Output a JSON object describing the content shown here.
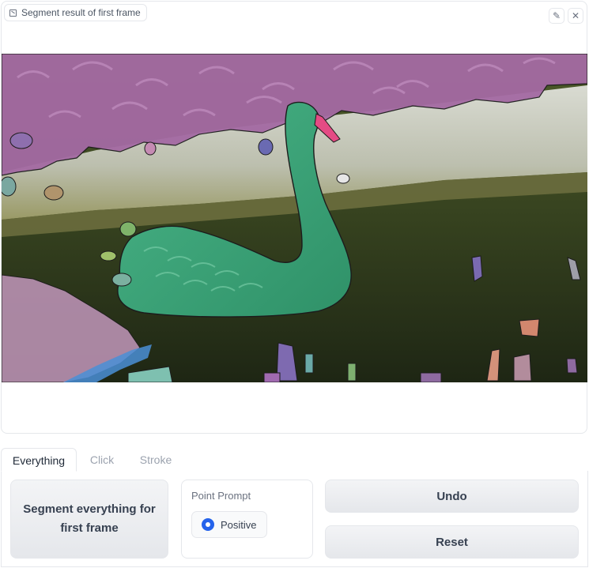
{
  "panel": {
    "label": "Segment result of first frame",
    "label_icon": "image-icon",
    "edit_icon": "pencil-icon",
    "close_icon": "close-icon"
  },
  "image": {
    "subject": "swan-segmentation-overlay",
    "colors": {
      "foliage_mask": "#a46aa3",
      "swan_mask": "#3aa37a",
      "water": "#3d4a26",
      "wall": "#cfd0c5",
      "reflection": "#b991b2"
    }
  },
  "tabs": [
    {
      "label": "Everything",
      "active": true
    },
    {
      "label": "Click",
      "active": false
    },
    {
      "label": "Stroke",
      "active": false
    }
  ],
  "controls": {
    "segment_button": "Segment everything for first frame",
    "point_prompt": {
      "title": "Point Prompt",
      "option": "Positive",
      "selected": true
    },
    "undo_button": "Undo",
    "reset_button": "Reset"
  },
  "accent_color": "#2563eb"
}
